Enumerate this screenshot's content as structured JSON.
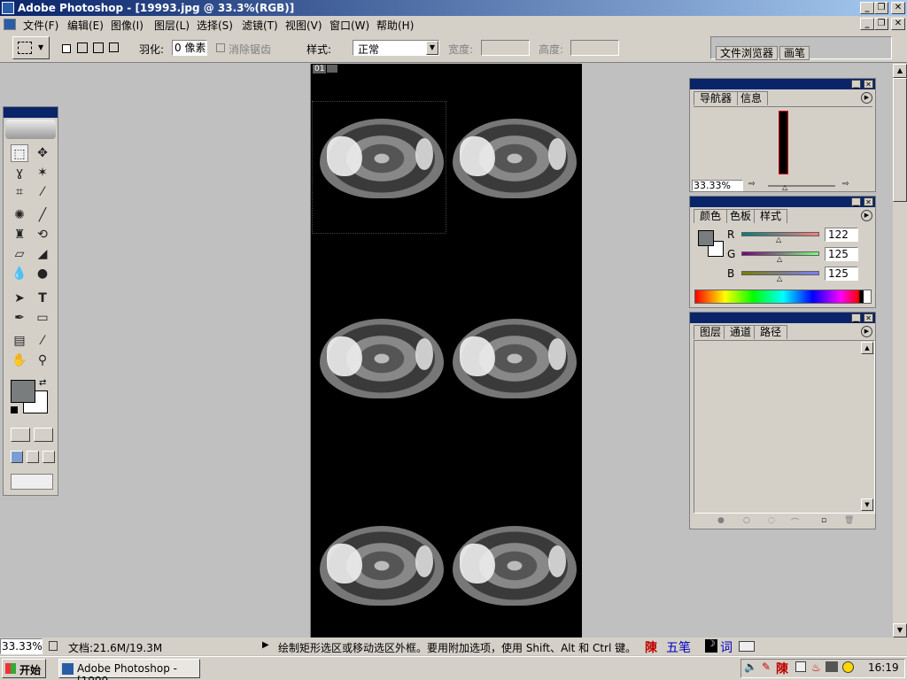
{
  "window": {
    "title": "Adobe Photoshop - [19993.jpg @ 33.3%(RGB)]",
    "minimize": "_",
    "restore": "❐",
    "close": "✕"
  },
  "menu": {
    "items": [
      "文件(F)",
      "编辑(E)",
      "图像(I)",
      "图层(L)",
      "选择(S)",
      "滤镜(T)",
      "视图(V)",
      "窗口(W)",
      "帮助(H)"
    ]
  },
  "options": {
    "feather_label": "羽化:",
    "feather_value": "0 像素",
    "antialias_label": "消除锯齿",
    "style_label": "样式:",
    "style_value": "正常",
    "width_label": "宽度:",
    "height_label": "高度:",
    "tab_file_browser": "文件浏览器",
    "tab_brushes": "画笔"
  },
  "document": {
    "corner_label": "01"
  },
  "panels": {
    "navigator": {
      "tabs": [
        "导航器",
        "信息"
      ],
      "zoom": "33.33%"
    },
    "color": {
      "tabs": [
        "颜色",
        "色板",
        "样式"
      ],
      "r_label": "R",
      "g_label": "G",
      "b_label": "B",
      "r_value": "122",
      "g_value": "125",
      "b_value": "125"
    },
    "layers": {
      "tabs": [
        "图层",
        "通道",
        "路径"
      ]
    }
  },
  "status": {
    "zoom": "33.33%",
    "doc_size": "文档:21.6M/19.3M",
    "hint": "绘制矩形选区或移动选区外框。要用附加选项，使用 Shift、Alt 和 Ctrl 键。",
    "ime_chen": "陳",
    "ime_wubi": "五笔",
    "ime_ci": "词"
  },
  "taskbar": {
    "start": "开始",
    "task": "Adobe Photoshop - [1999...",
    "tray_ime": "陳",
    "clock": "16:19"
  },
  "colors": {
    "title_bar": "#0a246a",
    "chrome": "#d4d0c8",
    "foreground_swatch": "#7a7d7d"
  }
}
